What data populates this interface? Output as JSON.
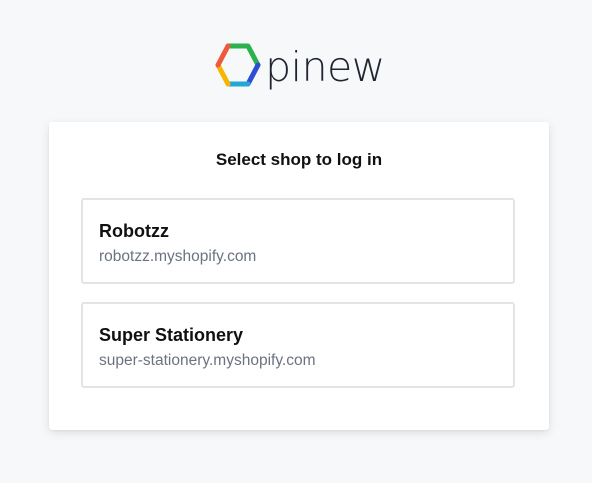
{
  "brand": {
    "logo_text": "pinew",
    "logo_colors": [
      "#ef5a3c",
      "#f7b500",
      "#2bb24c",
      "#2d7be5",
      "#7a4fd1"
    ]
  },
  "login": {
    "title": "Select shop to log in",
    "shops": [
      {
        "name": "Robotzz",
        "domain": "robotzz.myshopify.com"
      },
      {
        "name": "Super Stationery",
        "domain": "super-stationery.myshopify.com"
      }
    ]
  }
}
